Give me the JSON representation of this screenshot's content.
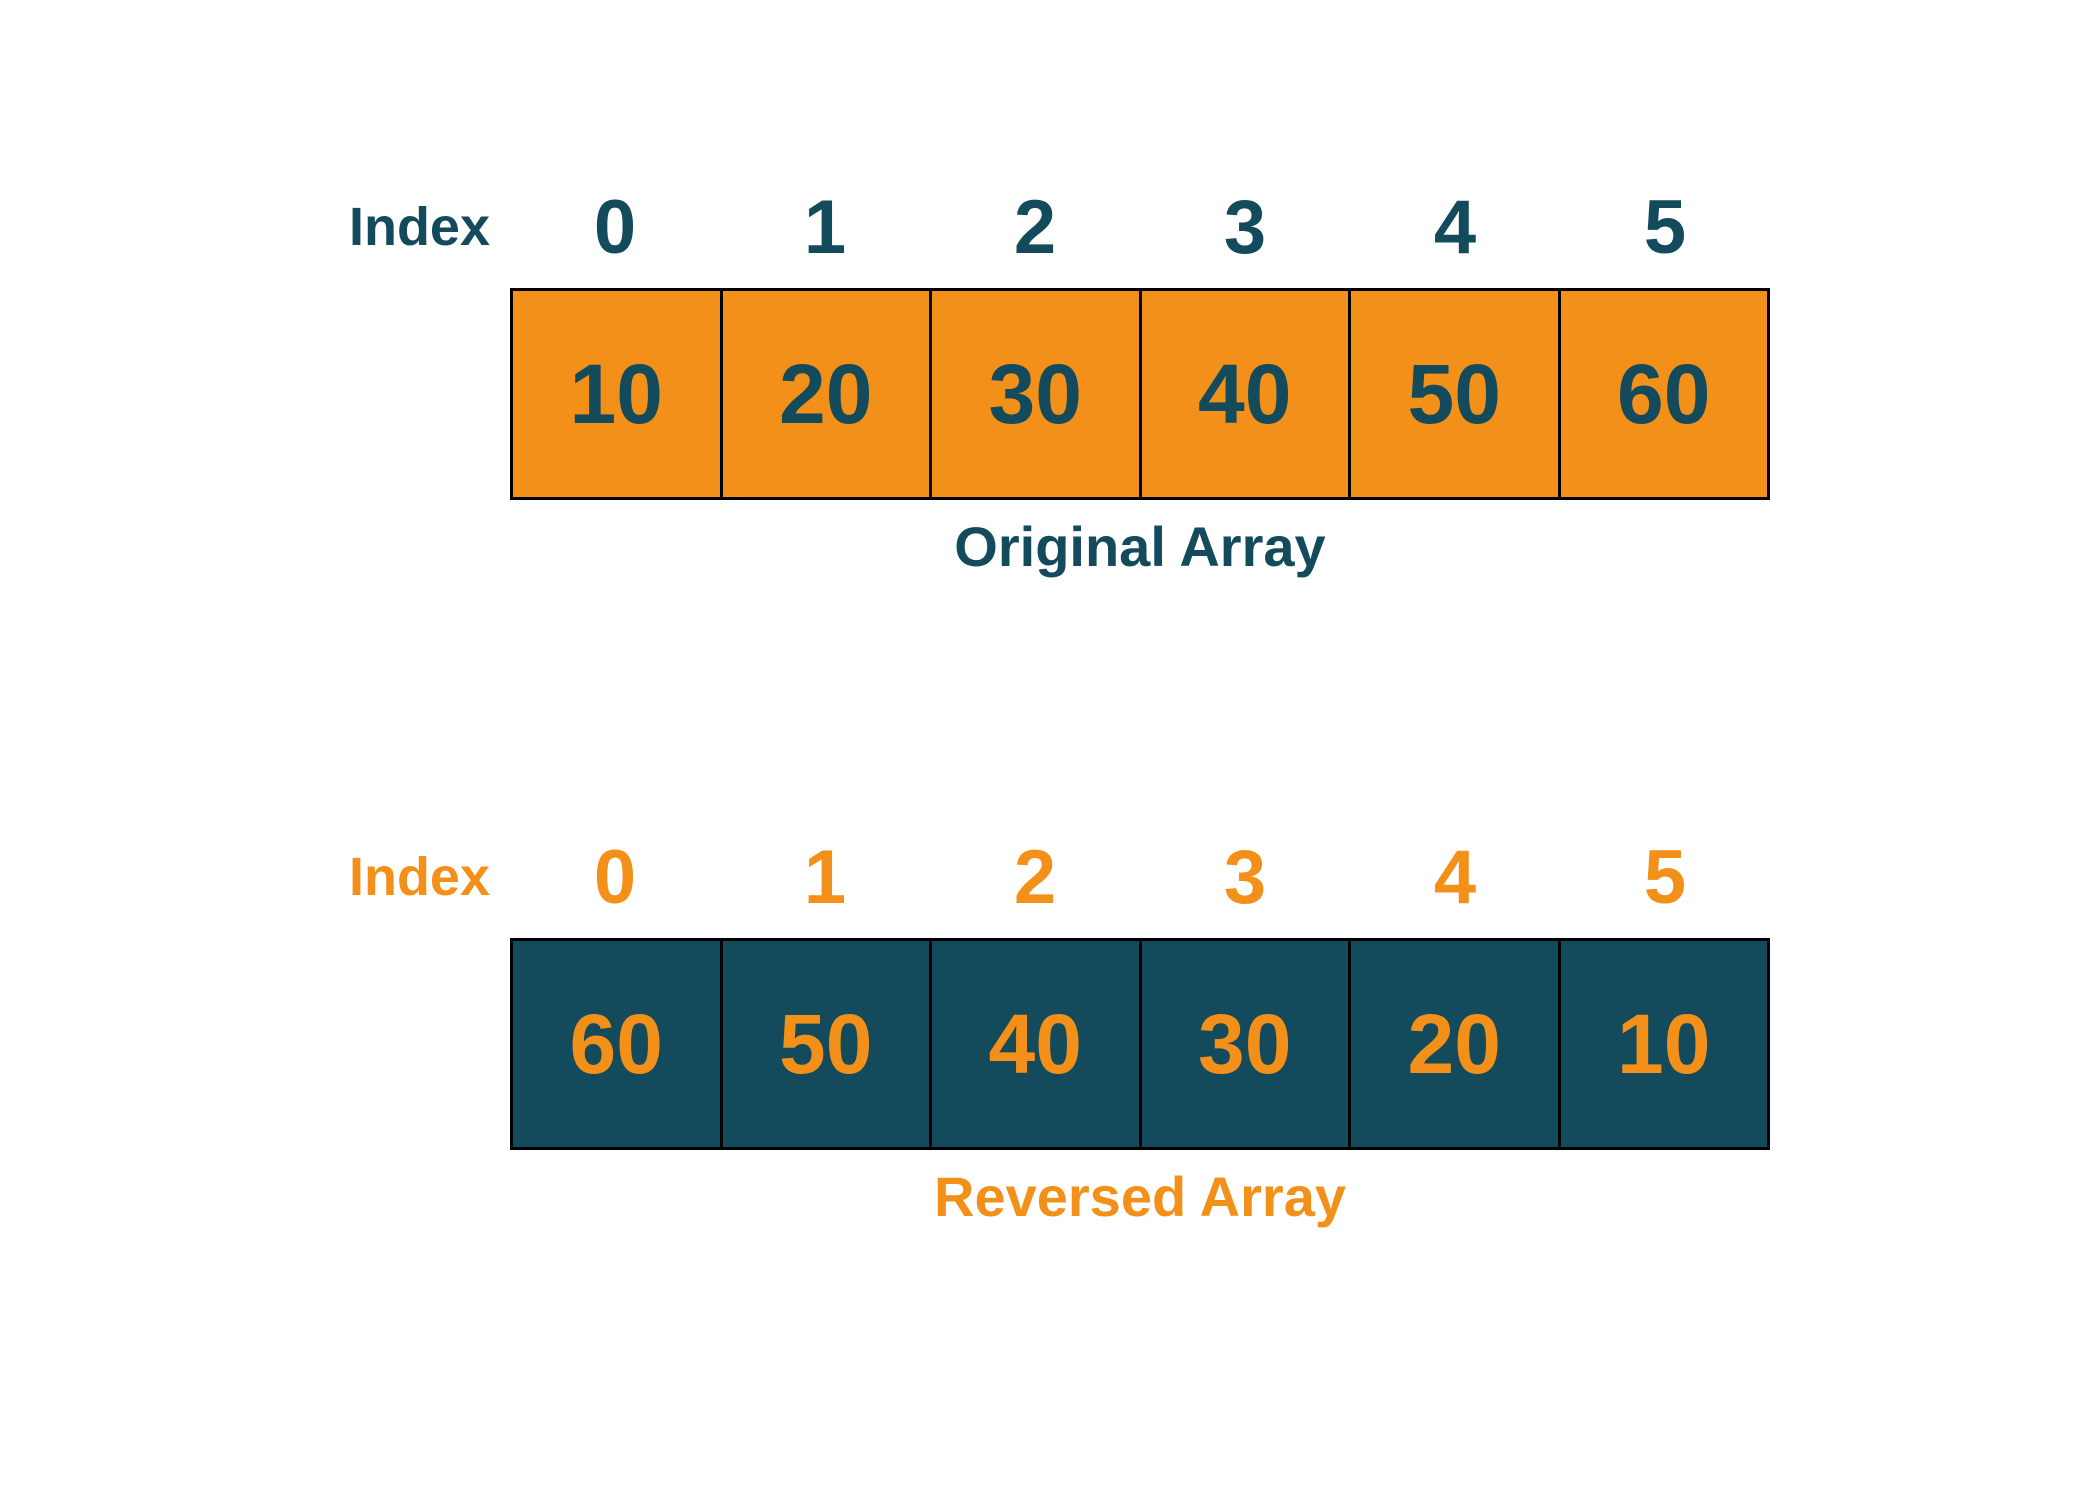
{
  "original": {
    "indexLabel": "Index",
    "indices": [
      "0",
      "1",
      "2",
      "3",
      "4",
      "5"
    ],
    "values": [
      "10",
      "20",
      "30",
      "40",
      "50",
      "60"
    ],
    "caption": "Original Array",
    "colors": {
      "text": "#134a5c",
      "cellBg": "#f39019",
      "cellText": "#134a5c"
    }
  },
  "reversed": {
    "indexLabel": "Index",
    "indices": [
      "0",
      "1",
      "2",
      "3",
      "4",
      "5"
    ],
    "values": [
      "60",
      "50",
      "40",
      "30",
      "20",
      "10"
    ],
    "caption": "Reversed Array",
    "colors": {
      "text": "#f39019",
      "cellBg": "#134a5c",
      "cellText": "#f39019"
    }
  }
}
